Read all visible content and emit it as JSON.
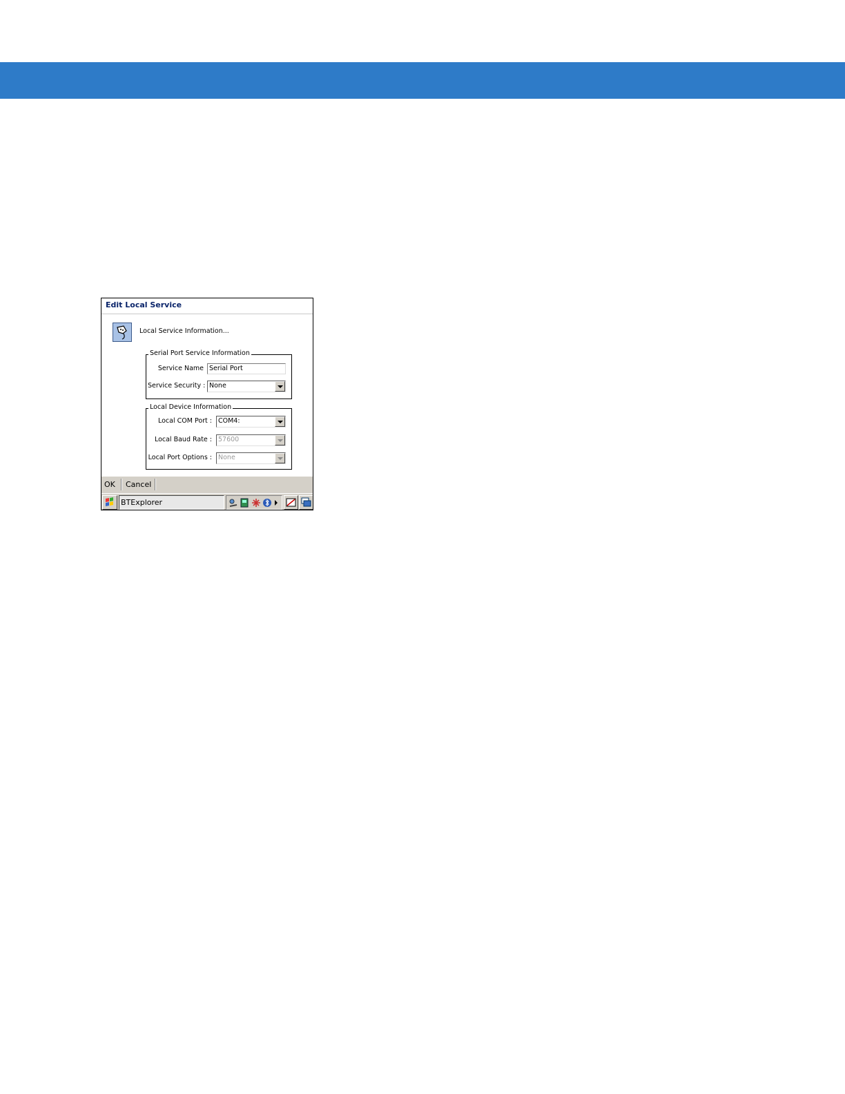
{
  "dialog": {
    "title": "Edit Local Service",
    "header_text": "Local Service Information..."
  },
  "serial_group": {
    "title": "Serial Port Service Information",
    "service_name_label": "Service Name",
    "service_name_value": "Serial Port",
    "service_security_label": "Service Security :",
    "service_security_value": "None"
  },
  "device_group": {
    "title": "Local Device Information",
    "com_port_label": "Local COM Port :",
    "com_port_value": "COM4:",
    "baud_rate_label": "Local Baud Rate :",
    "baud_rate_value": "57600",
    "port_options_label": "Local Port Options :",
    "port_options_value": "None"
  },
  "menubar": {
    "ok_label": "OK",
    "cancel_label": "Cancel"
  },
  "taskbar": {
    "task_label": "BTExplorer",
    "icons": [
      "network-icon",
      "sync-icon",
      "signal-icon",
      "bluetooth-icon",
      "tray-arrow-icon",
      "input-panel-icon",
      "desktop-icon"
    ]
  },
  "colors": {
    "top_band": "#2e7bc8",
    "title_text": "#0a246a",
    "chrome": "#d4d0c8"
  }
}
